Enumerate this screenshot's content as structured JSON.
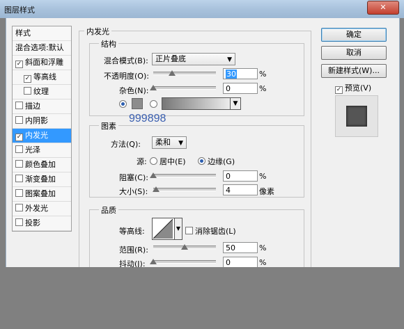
{
  "window": {
    "title": "图层样式",
    "close_icon": "close-icon"
  },
  "left_panel": {
    "header": "样式",
    "items": [
      {
        "label": "混合选项:默认",
        "checkbox": false,
        "checked": false,
        "indent": false,
        "selected": false
      },
      {
        "label": "斜面和浮雕",
        "checkbox": true,
        "checked": true,
        "indent": false,
        "selected": false
      },
      {
        "label": "等高线",
        "checkbox": true,
        "checked": true,
        "indent": true,
        "selected": false
      },
      {
        "label": "纹理",
        "checkbox": true,
        "checked": false,
        "indent": true,
        "selected": false
      },
      {
        "label": "描边",
        "checkbox": true,
        "checked": false,
        "indent": false,
        "selected": false
      },
      {
        "label": "内阴影",
        "checkbox": true,
        "checked": false,
        "indent": false,
        "selected": false
      },
      {
        "label": "内发光",
        "checkbox": true,
        "checked": true,
        "indent": false,
        "selected": true
      },
      {
        "label": "光泽",
        "checkbox": true,
        "checked": false,
        "indent": false,
        "selected": false
      },
      {
        "label": "颜色叠加",
        "checkbox": true,
        "checked": false,
        "indent": false,
        "selected": false
      },
      {
        "label": "渐变叠加",
        "checkbox": true,
        "checked": false,
        "indent": false,
        "selected": false
      },
      {
        "label": "图案叠加",
        "checkbox": true,
        "checked": false,
        "indent": false,
        "selected": false
      },
      {
        "label": "外发光",
        "checkbox": true,
        "checked": false,
        "indent": false,
        "selected": false
      },
      {
        "label": "投影",
        "checkbox": true,
        "checked": false,
        "indent": false,
        "selected": false
      }
    ]
  },
  "main": {
    "section_title": "内发光",
    "structure": {
      "title": "结构",
      "blend_mode_label": "混合模式(B):",
      "blend_mode_value": "正片叠底",
      "opacity_label": "不透明度(O):",
      "opacity_value": "30",
      "opacity_unit": "%",
      "opacity_level": 30,
      "noise_label": "杂色(N):",
      "noise_value": "0",
      "noise_unit": "%",
      "noise_level": 0,
      "color_swatch": "#8c8c8c",
      "watermark_color": "999898"
    },
    "elements": {
      "title": "图素",
      "method_label": "方法(Q):",
      "method_value": "柔和",
      "source_label": "源:",
      "source_center": "居中(E)",
      "source_edge": "边缘(G)",
      "choke_label": "阻塞(C):",
      "choke_value": "0",
      "choke_unit": "%",
      "choke_level": 0,
      "size_label": "大小(S):",
      "size_value": "4",
      "size_unit": "像素",
      "size_level": 4
    },
    "quality": {
      "title": "品质",
      "contour_label": "等高线:",
      "antialias_label": "消除锯齿(L)",
      "range_label": "范围(R):",
      "range_value": "50",
      "range_unit": "%",
      "range_level": 50,
      "jitter_label": "抖动(J):",
      "jitter_value": "0",
      "jitter_unit": "%",
      "jitter_level": 0
    }
  },
  "right_panel": {
    "ok": "确定",
    "cancel": "取消",
    "new_style": "新建样式(W)...",
    "preview": "预览(V)",
    "preview_checked": true
  },
  "colors": {
    "accent": "#3399ff",
    "titlebar": "#a9c2dc",
    "watermark": "#3a5fb0"
  }
}
